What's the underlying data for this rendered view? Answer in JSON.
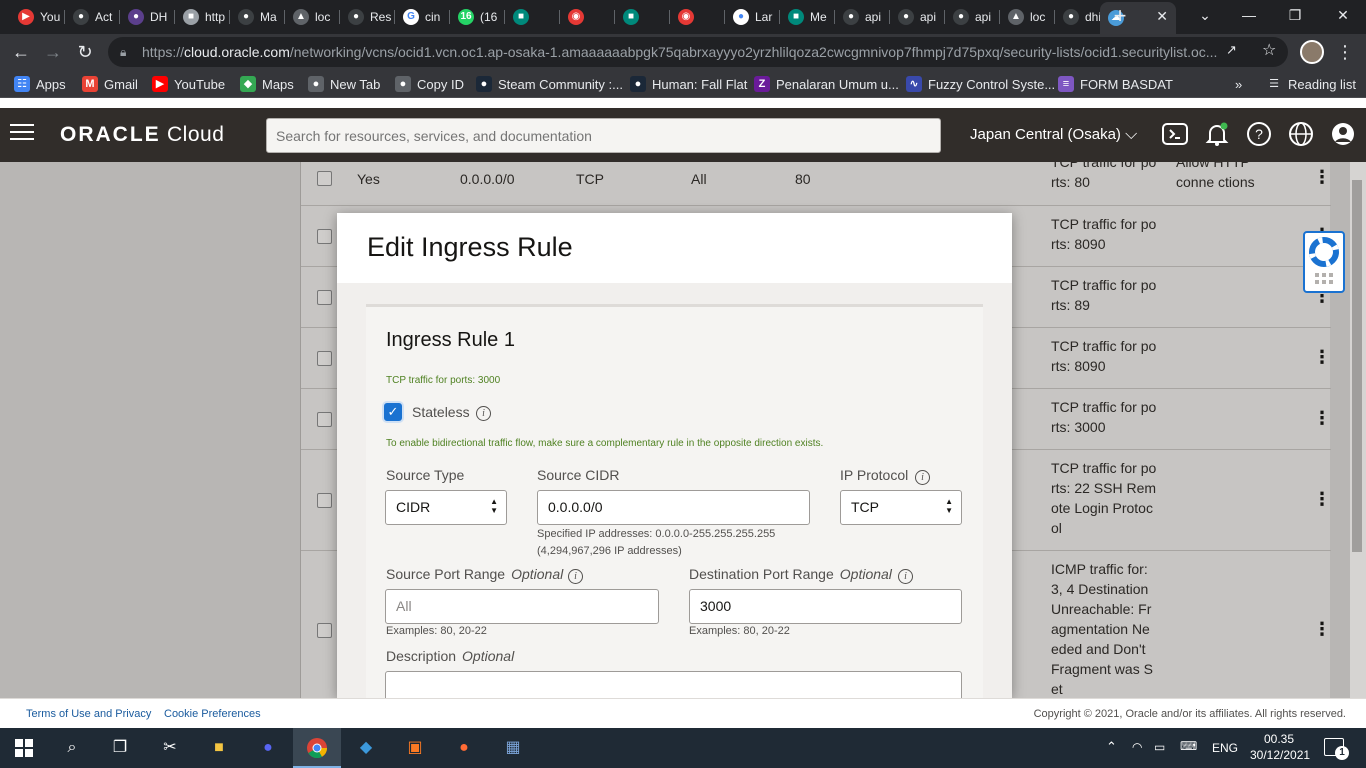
{
  "browser": {
    "tabs": [
      {
        "label": "You",
        "color": "#e53935",
        "glyph": "▶"
      },
      {
        "label": "Act",
        "color": "#3c4043",
        "glyph": "●"
      },
      {
        "label": "DH",
        "color": "#5b3f8c",
        "glyph": "●"
      },
      {
        "label": "http",
        "color": "#9aa0a6",
        "glyph": "■"
      },
      {
        "label": "Ma",
        "color": "#3c4043",
        "glyph": "●"
      },
      {
        "label": "loc",
        "color": "#5f6368",
        "glyph": "▲"
      },
      {
        "label": "Res",
        "color": "#3c4043",
        "glyph": "●"
      },
      {
        "label": "cin",
        "color": "#ffffff",
        "glyph": "G"
      },
      {
        "label": "(16",
        "color": "#25d366",
        "glyph": "16"
      },
      {
        "label": "",
        "color": "#00897b",
        "glyph": "■"
      },
      {
        "label": "",
        "color": "#e53935",
        "glyph": "◉"
      },
      {
        "label": "",
        "color": "#00897b",
        "glyph": "■"
      },
      {
        "label": "",
        "color": "#e53935",
        "glyph": "◉"
      },
      {
        "label": "Lar",
        "color": "#ffffff",
        "glyph": "●"
      },
      {
        "label": "Me",
        "color": "#00897b",
        "glyph": "■"
      },
      {
        "label": "api",
        "color": "#3c4043",
        "glyph": "●"
      },
      {
        "label": "api",
        "color": "#3c4043",
        "glyph": "●"
      },
      {
        "label": "api",
        "color": "#3c4043",
        "glyph": "●"
      },
      {
        "label": "loc",
        "color": "#5f6368",
        "glyph": "▲"
      },
      {
        "label": "dhi",
        "color": "#3c4043",
        "glyph": "●"
      },
      {
        "label": "",
        "color": "#4a9bd8",
        "glyph": "☁"
      }
    ],
    "url_prefix": "https://",
    "url_host": "cloud.oracle.com",
    "url_path": "/networking/vcns/ocid1.vcn.oc1.ap-osaka-1.amaaaaaabpgk75qabrxayyyo2yrzhlilqoza2cwcgmnivop7fhmpj7d75pxq/security-lists/ocid1.securitylist.oc...",
    "bookmarks": [
      {
        "label": "Apps",
        "color": "#4285f4",
        "glyph": "☷"
      },
      {
        "label": "Gmail",
        "color": "#ea4335",
        "glyph": "M"
      },
      {
        "label": "YouTube",
        "color": "#ff0000",
        "glyph": "▶"
      },
      {
        "label": "Maps",
        "color": "#34a853",
        "glyph": "◆"
      },
      {
        "label": "New Tab",
        "color": "#5f6368",
        "glyph": "●"
      },
      {
        "label": "Copy ID",
        "color": "#5f6368",
        "glyph": "●"
      },
      {
        "label": "Steam Community :...",
        "color": "#1b2838",
        "glyph": "●"
      },
      {
        "label": "Human: Fall Flat",
        "color": "#1b2838",
        "glyph": "●"
      },
      {
        "label": "Penalaran Umum u...",
        "color": "#6a1b9a",
        "glyph": "Z"
      },
      {
        "label": "Fuzzy Control Syste...",
        "color": "#3949ab",
        "glyph": "∿"
      },
      {
        "label": "FORM BASDAT",
        "color": "#7e57c2",
        "glyph": "≡"
      }
    ],
    "bookmarks_overflow": "»",
    "reading_list": "Reading list"
  },
  "oracle": {
    "logo_bold": "ORACLE",
    "logo_light": "Cloud",
    "search_placeholder": "Search for resources, services, and documentation",
    "region": "Japan Central (Osaka)"
  },
  "table": {
    "rows": [
      {
        "cells": [
          "Yes",
          "0.0.0.0/0",
          "TCP",
          "All",
          "80"
        ],
        "desc": "TCP traffic for po rts: 80",
        "desc2": "Allow HTTP conne ctions"
      },
      {
        "desc": "TCP traffic for po rts: 8090"
      },
      {
        "desc": "TCP traffic for po rts: 89"
      },
      {
        "desc": "TCP traffic for po rts: 8090"
      },
      {
        "desc": "TCP traffic for po rts: 3000"
      },
      {
        "desc": "TCP traffic for po rts: 22 SSH Rem ote Login Protoc ol"
      },
      {
        "desc": "ICMP traffic for: 3, 4 Destination Unreachable: Fr agmentation Ne eded and Don't Fragment was S et"
      }
    ]
  },
  "modal": {
    "title": "Edit Ingress Rule",
    "rule_title": "Ingress Rule 1",
    "rule_subtitle": "TCP traffic for ports: 3000",
    "stateless_label": "Stateless",
    "stateless_checked": true,
    "bidir_note": "To enable bidirectional traffic flow, make sure a complementary rule in the opposite direction exists.",
    "source_type_label": "Source Type",
    "source_type_value": "CIDR",
    "source_cidr_label": "Source CIDR",
    "source_cidr_value": "0.0.0.0/0",
    "source_cidr_hint1": "Specified IP addresses: 0.0.0.0-255.255.255.255",
    "source_cidr_hint2": "(4,294,967,296 IP addresses)",
    "ip_protocol_label": "IP Protocol",
    "ip_protocol_value": "TCP",
    "src_port_label": "Source Port Range",
    "optional": "Optional",
    "src_port_placeholder": "All",
    "dst_port_label": "Destination Port Range",
    "dst_port_value": "3000",
    "port_examples": "Examples: 80, 20-22",
    "description_label": "Description"
  },
  "footer": {
    "terms": "Terms of Use and Privacy",
    "cookies": "Cookie Preferences",
    "copyright": "Copyright © 2021, Oracle and/or its affiliates. All rights reserved."
  },
  "taskbar": {
    "language": "ENG",
    "time": "00.35",
    "date": "30/12/2021",
    "notifications": "1"
  }
}
